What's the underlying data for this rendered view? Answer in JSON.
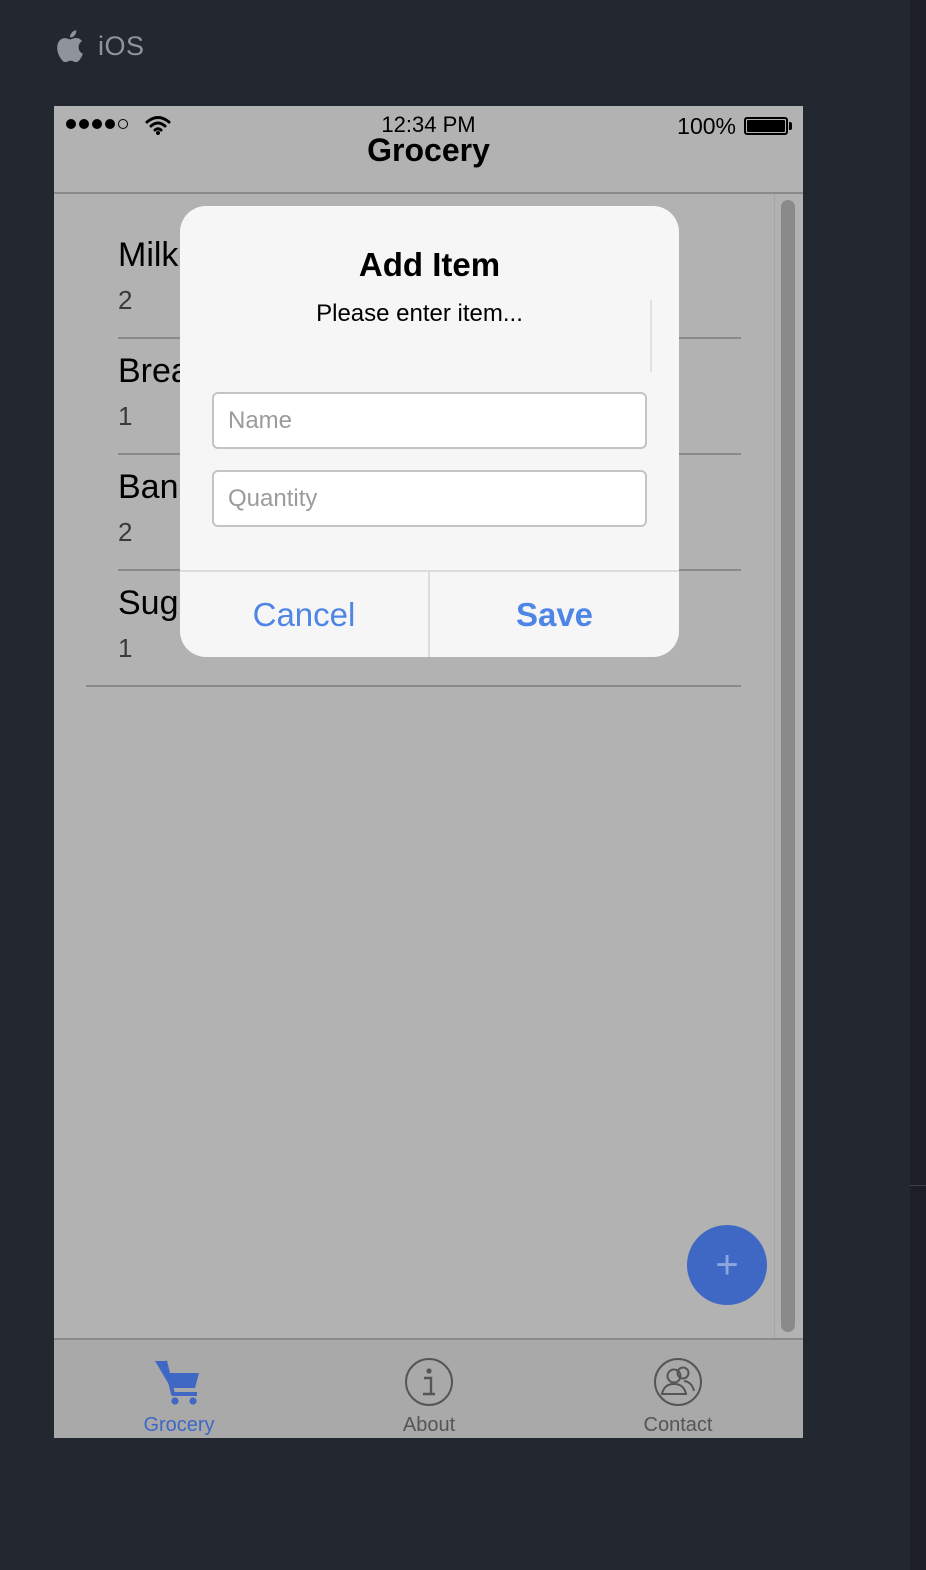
{
  "platform": {
    "label": "iOS",
    "icon": "apple-icon"
  },
  "status_bar": {
    "time": "12:34 PM",
    "battery": "100%",
    "signal_bars": 4,
    "signal_max": 5
  },
  "nav": {
    "title": "Grocery"
  },
  "items": [
    {
      "name": "Milk",
      "quantity": "2"
    },
    {
      "name": "Bread",
      "quantity": "1"
    },
    {
      "name": "Bananas",
      "quantity": "2"
    },
    {
      "name": "Sugar",
      "quantity": "1"
    }
  ],
  "fab": {
    "label": "+",
    "icon": "plus-icon"
  },
  "tabs": [
    {
      "label": "Grocery",
      "icon": "cart-icon",
      "active": true
    },
    {
      "label": "About",
      "icon": "info-icon",
      "active": false
    },
    {
      "label": "Contact",
      "icon": "contacts-icon",
      "active": false
    }
  ],
  "dialog": {
    "title": "Add Item",
    "message": "Please enter item...",
    "name_placeholder": "Name",
    "quantity_placeholder": "Quantity",
    "cancel_label": "Cancel",
    "save_label": "Save"
  },
  "colors": {
    "accent": "#3f67c4",
    "dialog_button": "#4f86e6",
    "background": "#23272f"
  }
}
